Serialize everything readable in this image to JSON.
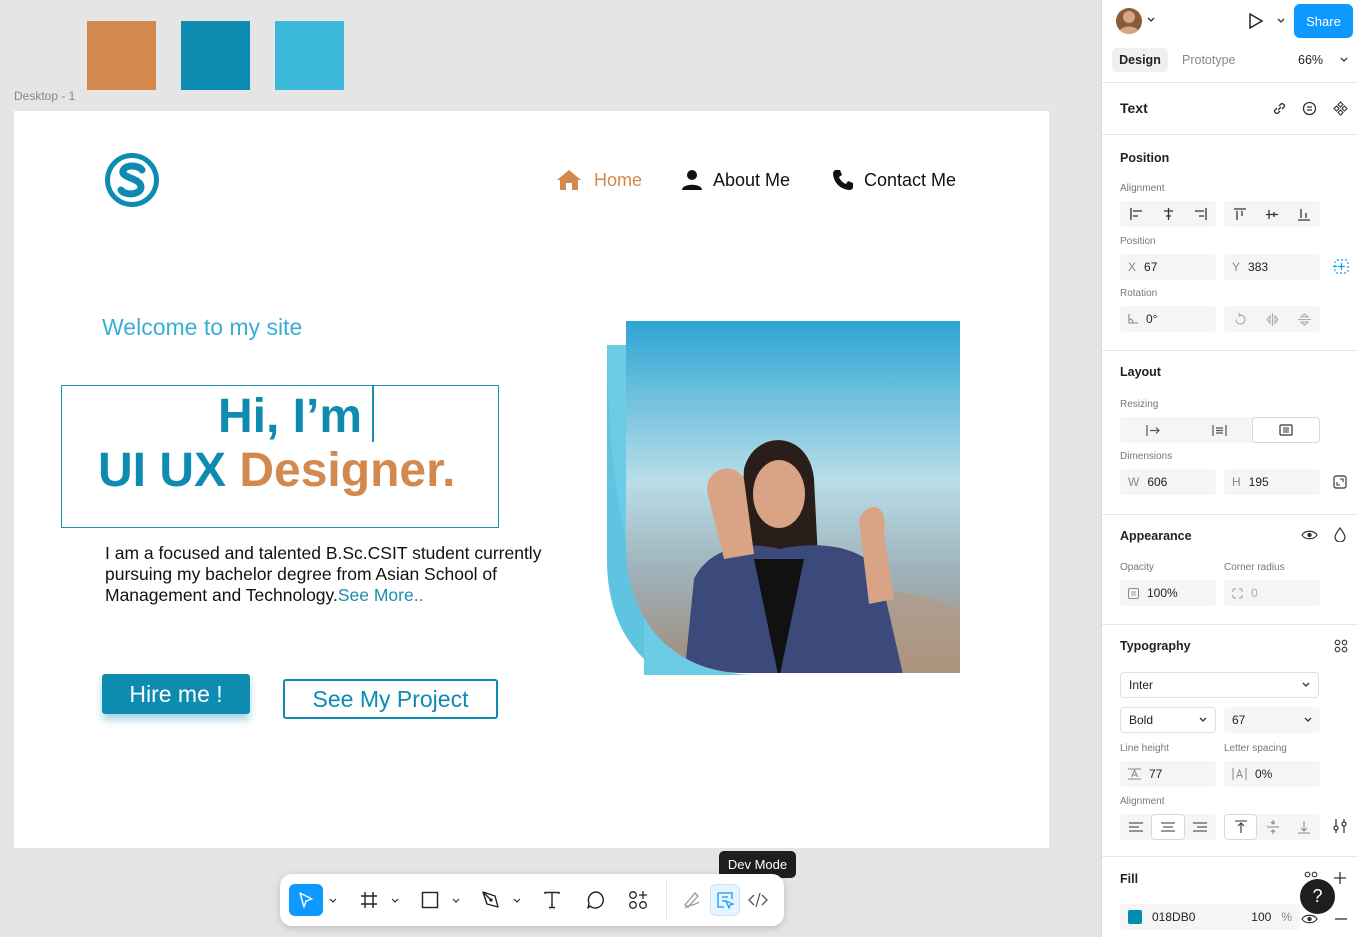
{
  "canvas": {
    "swatches": [
      "#D3884D",
      "#0E8BB0",
      "#3CB8DB"
    ],
    "frame_label": "Desktop - 1"
  },
  "site": {
    "nav": [
      {
        "label": "Home",
        "icon": "home-icon",
        "color": "#D3884D"
      },
      {
        "label": "About Me",
        "icon": "person-icon",
        "color": "#111111"
      },
      {
        "label": "Contact Me",
        "icon": "phone-icon",
        "color": "#111111"
      }
    ],
    "welcome": "Welcome to my site",
    "hero_line1": "Hi, I’m",
    "hero_line2_a": "UI UX ",
    "hero_line2_b": "Designer.",
    "description": "I am a focused and talented B.Sc.CSIT student currently pursuing my bachelor degree from Asian School of Management and Technology.",
    "see_more": "See More..",
    "hire_button": "Hire me !",
    "project_button": "See My Project"
  },
  "panel": {
    "share": "Share",
    "tabs": [
      "Design",
      "Prototype"
    ],
    "zoom": "66%",
    "layer_type": "Text",
    "position": {
      "title": "Position",
      "alignment_label": "Alignment",
      "position_label": "Position",
      "x_label": "X",
      "x": "67",
      "y_label": "Y",
      "y": "383",
      "rotation_label": "Rotation",
      "rotation": "0°"
    },
    "layout": {
      "title": "Layout",
      "resizing_label": "Resizing",
      "dimensions_label": "Dimensions",
      "w_label": "W",
      "w": "606",
      "h_label": "H",
      "h": "195"
    },
    "appearance": {
      "title": "Appearance",
      "opacity_label": "Opacity",
      "opacity": "100%",
      "radius_label": "Corner radius",
      "radius": "0"
    },
    "typography": {
      "title": "Typography",
      "font": "Inter",
      "weight": "Bold",
      "size": "67",
      "line_height_label": "Line height",
      "line_height": "77",
      "letter_spacing_label": "Letter spacing",
      "letter_spacing": "0%",
      "alignment_label": "Alignment"
    },
    "fill": {
      "title": "Fill",
      "color": "#018DB0",
      "hex": "018DB0",
      "opacity": "100",
      "unit": "%"
    }
  },
  "toolbar": {
    "tooltip": "Dev Mode",
    "tools": [
      "move-tool",
      "frame-tool",
      "shape-tool",
      "pen-tool",
      "text-tool",
      "comment-tool",
      "actions-tool",
      "draw-mode",
      "design-mode",
      "dev-mode"
    ]
  },
  "help": "?"
}
